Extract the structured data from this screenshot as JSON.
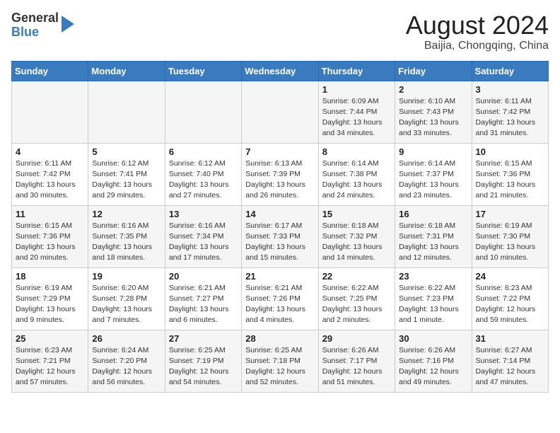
{
  "header": {
    "logo_line1": "General",
    "logo_line2": "Blue",
    "month_title": "August 2024",
    "location": "Baijia, Chongqing, China"
  },
  "days_of_week": [
    "Sunday",
    "Monday",
    "Tuesday",
    "Wednesday",
    "Thursday",
    "Friday",
    "Saturday"
  ],
  "weeks": [
    [
      {
        "day": "",
        "info": ""
      },
      {
        "day": "",
        "info": ""
      },
      {
        "day": "",
        "info": ""
      },
      {
        "day": "",
        "info": ""
      },
      {
        "day": "1",
        "info": "Sunrise: 6:09 AM\nSunset: 7:44 PM\nDaylight: 13 hours\nand 34 minutes."
      },
      {
        "day": "2",
        "info": "Sunrise: 6:10 AM\nSunset: 7:43 PM\nDaylight: 13 hours\nand 33 minutes."
      },
      {
        "day": "3",
        "info": "Sunrise: 6:11 AM\nSunset: 7:42 PM\nDaylight: 13 hours\nand 31 minutes."
      }
    ],
    [
      {
        "day": "4",
        "info": "Sunrise: 6:11 AM\nSunset: 7:42 PM\nDaylight: 13 hours\nand 30 minutes."
      },
      {
        "day": "5",
        "info": "Sunrise: 6:12 AM\nSunset: 7:41 PM\nDaylight: 13 hours\nand 29 minutes."
      },
      {
        "day": "6",
        "info": "Sunrise: 6:12 AM\nSunset: 7:40 PM\nDaylight: 13 hours\nand 27 minutes."
      },
      {
        "day": "7",
        "info": "Sunrise: 6:13 AM\nSunset: 7:39 PM\nDaylight: 13 hours\nand 26 minutes."
      },
      {
        "day": "8",
        "info": "Sunrise: 6:14 AM\nSunset: 7:38 PM\nDaylight: 13 hours\nand 24 minutes."
      },
      {
        "day": "9",
        "info": "Sunrise: 6:14 AM\nSunset: 7:37 PM\nDaylight: 13 hours\nand 23 minutes."
      },
      {
        "day": "10",
        "info": "Sunrise: 6:15 AM\nSunset: 7:36 PM\nDaylight: 13 hours\nand 21 minutes."
      }
    ],
    [
      {
        "day": "11",
        "info": "Sunrise: 6:15 AM\nSunset: 7:36 PM\nDaylight: 13 hours\nand 20 minutes."
      },
      {
        "day": "12",
        "info": "Sunrise: 6:16 AM\nSunset: 7:35 PM\nDaylight: 13 hours\nand 18 minutes."
      },
      {
        "day": "13",
        "info": "Sunrise: 6:16 AM\nSunset: 7:34 PM\nDaylight: 13 hours\nand 17 minutes."
      },
      {
        "day": "14",
        "info": "Sunrise: 6:17 AM\nSunset: 7:33 PM\nDaylight: 13 hours\nand 15 minutes."
      },
      {
        "day": "15",
        "info": "Sunrise: 6:18 AM\nSunset: 7:32 PM\nDaylight: 13 hours\nand 14 minutes."
      },
      {
        "day": "16",
        "info": "Sunrise: 6:18 AM\nSunset: 7:31 PM\nDaylight: 13 hours\nand 12 minutes."
      },
      {
        "day": "17",
        "info": "Sunrise: 6:19 AM\nSunset: 7:30 PM\nDaylight: 13 hours\nand 10 minutes."
      }
    ],
    [
      {
        "day": "18",
        "info": "Sunrise: 6:19 AM\nSunset: 7:29 PM\nDaylight: 13 hours\nand 9 minutes."
      },
      {
        "day": "19",
        "info": "Sunrise: 6:20 AM\nSunset: 7:28 PM\nDaylight: 13 hours\nand 7 minutes."
      },
      {
        "day": "20",
        "info": "Sunrise: 6:21 AM\nSunset: 7:27 PM\nDaylight: 13 hours\nand 6 minutes."
      },
      {
        "day": "21",
        "info": "Sunrise: 6:21 AM\nSunset: 7:26 PM\nDaylight: 13 hours\nand 4 minutes."
      },
      {
        "day": "22",
        "info": "Sunrise: 6:22 AM\nSunset: 7:25 PM\nDaylight: 13 hours\nand 2 minutes."
      },
      {
        "day": "23",
        "info": "Sunrise: 6:22 AM\nSunset: 7:23 PM\nDaylight: 13 hours\nand 1 minute."
      },
      {
        "day": "24",
        "info": "Sunrise: 6:23 AM\nSunset: 7:22 PM\nDaylight: 12 hours\nand 59 minutes."
      }
    ],
    [
      {
        "day": "25",
        "info": "Sunrise: 6:23 AM\nSunset: 7:21 PM\nDaylight: 12 hours\nand 57 minutes."
      },
      {
        "day": "26",
        "info": "Sunrise: 6:24 AM\nSunset: 7:20 PM\nDaylight: 12 hours\nand 56 minutes."
      },
      {
        "day": "27",
        "info": "Sunrise: 6:25 AM\nSunset: 7:19 PM\nDaylight: 12 hours\nand 54 minutes."
      },
      {
        "day": "28",
        "info": "Sunrise: 6:25 AM\nSunset: 7:18 PM\nDaylight: 12 hours\nand 52 minutes."
      },
      {
        "day": "29",
        "info": "Sunrise: 6:26 AM\nSunset: 7:17 PM\nDaylight: 12 hours\nand 51 minutes."
      },
      {
        "day": "30",
        "info": "Sunrise: 6:26 AM\nSunset: 7:16 PM\nDaylight: 12 hours\nand 49 minutes."
      },
      {
        "day": "31",
        "info": "Sunrise: 6:27 AM\nSunset: 7:14 PM\nDaylight: 12 hours\nand 47 minutes."
      }
    ]
  ]
}
